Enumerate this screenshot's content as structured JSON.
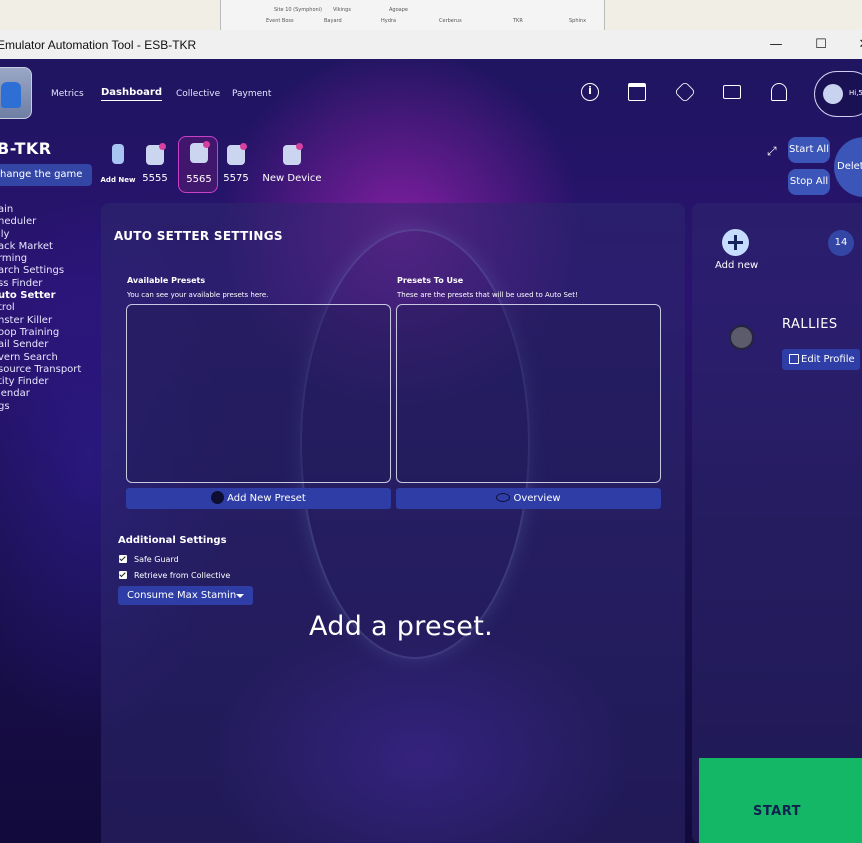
{
  "window": {
    "title": "Emulator Automation Tool - ESB-TKR",
    "minimize_glyph": "—",
    "maximize_glyph": "☐",
    "close_glyph": "✕"
  },
  "background_sheet": {
    "texts": [
      "Site 10 (Symphoni)",
      "Vikings",
      "Agoape",
      "Event Boss",
      "Bayard",
      "Hydra",
      "Cerberus",
      "TKR",
      "Sphinx"
    ]
  },
  "header": {
    "nav": [
      "Metrics",
      "Dashboard",
      "Collective",
      "Payment"
    ],
    "active_nav": "Dashboard",
    "icons": [
      "info-icon",
      "calendar-icon",
      "settings-icon",
      "mail-icon",
      "bell-icon"
    ],
    "greeting": "Hi,5"
  },
  "sidebar": {
    "brand": "B-TKR",
    "change_game": "hange the game",
    "items": [
      "ain",
      "heduler",
      "lly",
      "ack Market",
      "rming",
      "arch Settings",
      "ss Finder",
      "uto Setter",
      "trol",
      "nster Killer",
      "oop Training",
      "ail Sender",
      "vern Search",
      "source Transport",
      "tity Finder",
      "lendar",
      "gs"
    ],
    "active_index": 7
  },
  "devices": {
    "add_label": "Add New",
    "items": [
      "5555",
      "5565",
      "5575",
      "New Device"
    ],
    "selected": "5565",
    "start_all": "Start All",
    "stop_all": "Stop All",
    "delete": "Delet"
  },
  "auto_setter": {
    "title": "AUTO SETTER SETTINGS",
    "available_title": "Available Presets",
    "available_desc": "You can see your available presets here.",
    "to_use_title": "Presets To Use",
    "to_use_desc": "These are the presets that will be used to Auto Set!",
    "add_preset": "Add New Preset",
    "overview": "Overview",
    "additional_title": "Additional Settings",
    "safe_guard": "Safe Guard",
    "retrieve": "Retrieve from Collective",
    "consume_select": "Consume Max Stamin",
    "hint": "Add a  preset."
  },
  "right_panel": {
    "add_new": "Add new",
    "count": "14",
    "rallies": "RALLIES",
    "edit_profile": "Edit Profile",
    "start": "START"
  },
  "colors": {
    "accent_button": "#2f3ea7",
    "start_green": "#13b766",
    "selected_device": "#c940c9"
  }
}
